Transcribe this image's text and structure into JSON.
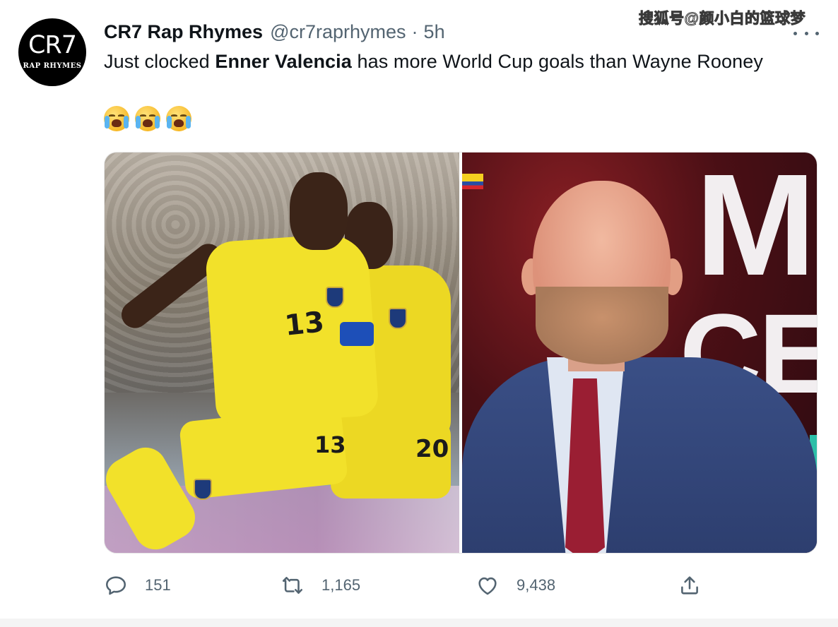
{
  "watermark": "搜狐号@颜小白的篮球梦",
  "author": {
    "avatar_text": "CR7",
    "avatar_subtext": "RAP RHYMES",
    "name": "CR7 Rap Rhymes",
    "handle": "@cr7raprhymes",
    "separator": "·",
    "time": "5h"
  },
  "text": {
    "part1": "Just clocked ",
    "bold": "Enner Valencia",
    "part2": " has more World Cup goals than Wayne Rooney"
  },
  "emojis": [
    "loudly-crying-face",
    "loudly-crying-face",
    "loudly-crying-face"
  ],
  "media": {
    "left": {
      "shirt_numbers": [
        "13",
        "13",
        "20"
      ]
    },
    "right": {
      "background_text": [
        "M",
        "CE"
      ]
    }
  },
  "actions": {
    "replies": "151",
    "retweets": "1,165",
    "likes": "9,438"
  },
  "colors": {
    "text_primary": "#0f1419",
    "text_secondary": "#536471",
    "ecuador_yellow": "#f2e12a",
    "suit_blue": "#3a4f86"
  }
}
